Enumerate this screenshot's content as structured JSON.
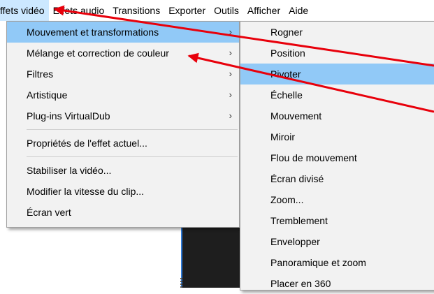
{
  "menubar": [
    {
      "label": "ffets vidéo",
      "active": true
    },
    {
      "label": "Effets audio"
    },
    {
      "label": "Transitions"
    },
    {
      "label": "Exporter"
    },
    {
      "label": "Outils"
    },
    {
      "label": "Afficher"
    },
    {
      "label": "Aide"
    }
  ],
  "video_effects_menu": {
    "items": [
      {
        "label": "Mouvement et transformations",
        "has_submenu": true,
        "open": true
      },
      {
        "label": "Mélange et correction de couleur",
        "has_submenu": true
      },
      {
        "label": "Filtres",
        "has_submenu": true
      },
      {
        "label": "Artistique",
        "has_submenu": true
      },
      {
        "label": "Plug-ins VirtualDub",
        "has_submenu": true
      }
    ],
    "items2": [
      {
        "label": "Propriétés de l'effet actuel..."
      }
    ],
    "items3": [
      {
        "label": "Stabiliser la vidéo..."
      },
      {
        "label": "Modifier la vitesse du clip..."
      },
      {
        "label": "Écran vert"
      }
    ],
    "submenu_arrow": "›"
  },
  "motion_submenu": {
    "items": [
      {
        "label": "Rogner"
      },
      {
        "label": "Position"
      },
      {
        "label": "Pivoter",
        "highlighted": true
      },
      {
        "label": "Échelle"
      },
      {
        "label": "Mouvement"
      },
      {
        "label": "Miroir"
      },
      {
        "label": "Flou de mouvement"
      },
      {
        "label": "Écran divisé"
      },
      {
        "label": "Zoom..."
      },
      {
        "label": "Tremblement"
      },
      {
        "label": "Envelopper"
      },
      {
        "label": "Panoramique et zoom"
      },
      {
        "label": "Placer en 360"
      }
    ]
  },
  "annotation_color": "#e8000b",
  "highlight_color": "#91c9f7"
}
